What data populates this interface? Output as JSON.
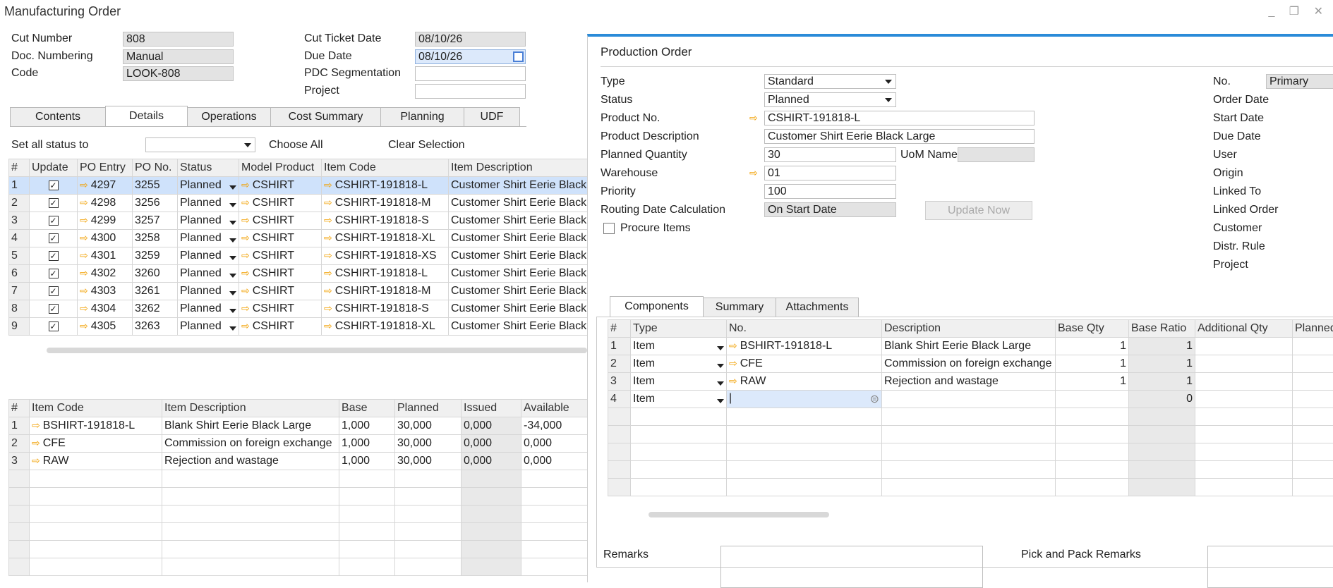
{
  "window": {
    "title": "Manufacturing Order",
    "controls": "_ ❐ ✕"
  },
  "header": {
    "cut_number_label": "Cut Number",
    "cut_number": "808",
    "doc_numbering_label": "Doc. Numbering",
    "doc_numbering": "Manual",
    "code_label": "Code",
    "code": "LOOK-808",
    "cut_ticket_date_label": "Cut Ticket Date",
    "cut_ticket_date": "08/10/26",
    "due_date_label": "Due Date",
    "due_date": "08/10/26",
    "pdc_label": "PDC Segmentation",
    "pdc": "",
    "project_label": "Project",
    "project": ""
  },
  "tabs": [
    "Contents",
    "Details",
    "Operations",
    "Cost Summary",
    "Planning",
    "UDF"
  ],
  "status_bar": {
    "set_all_label": "Set all status to",
    "choose_all": "Choose All",
    "clear_selection": "Clear Selection"
  },
  "po_table": {
    "headers": [
      "#",
      "Update",
      "PO Entry",
      "PO No.",
      "Status",
      "Model Product",
      "Item Code",
      "Item Description"
    ],
    "rows": [
      [
        "1",
        "4297",
        "3255",
        "Planned",
        "CSHIRT",
        "CSHIRT-191818-L",
        "Customer Shirt Eerie Black"
      ],
      [
        "2",
        "4298",
        "3256",
        "Planned",
        "CSHIRT",
        "CSHIRT-191818-M",
        "Customer Shirt Eerie Black"
      ],
      [
        "3",
        "4299",
        "3257",
        "Planned",
        "CSHIRT",
        "CSHIRT-191818-S",
        "Customer Shirt Eerie Black"
      ],
      [
        "4",
        "4300",
        "3258",
        "Planned",
        "CSHIRT",
        "CSHIRT-191818-XL",
        "Customer Shirt Eerie Black"
      ],
      [
        "5",
        "4301",
        "3259",
        "Planned",
        "CSHIRT",
        "CSHIRT-191818-XS",
        "Customer Shirt Eerie Black"
      ],
      [
        "6",
        "4302",
        "3260",
        "Planned",
        "CSHIRT",
        "CSHIRT-191818-L",
        "Customer Shirt Eerie Black"
      ],
      [
        "7",
        "4303",
        "3261",
        "Planned",
        "CSHIRT",
        "CSHIRT-191818-M",
        "Customer Shirt Eerie Black"
      ],
      [
        "8",
        "4304",
        "3262",
        "Planned",
        "CSHIRT",
        "CSHIRT-191818-S",
        "Customer Shirt Eerie Black"
      ],
      [
        "9",
        "4305",
        "3263",
        "Planned",
        "CSHIRT",
        "CSHIRT-191818-XL",
        "Customer Shirt Eerie Black"
      ]
    ]
  },
  "comp_table": {
    "headers": [
      "#",
      "Item Code",
      "Item Description",
      "Base",
      "Planned",
      "Issued",
      "Available"
    ],
    "rows": [
      [
        "1",
        "BSHIRT-191818-L",
        "Blank Shirt Eerie Black Large",
        "1,000",
        "30,000",
        "0,000",
        "-34,000"
      ],
      [
        "2",
        "CFE",
        "Commission on foreign exchange",
        "1,000",
        "30,000",
        "0,000",
        "0,000"
      ],
      [
        "3",
        "RAW",
        "Rejection and wastage",
        "1,000",
        "30,000",
        "0,000",
        "0,000"
      ]
    ]
  },
  "production_order": {
    "title": "Production Order",
    "type_label": "Type",
    "type": "Standard",
    "status_label": "Status",
    "status": "Planned",
    "product_no_label": "Product No.",
    "product_no": "CSHIRT-191818-L",
    "product_desc_label": "Product Description",
    "product_desc": "Customer Shirt Eerie Black Large",
    "planned_qty_label": "Planned Quantity",
    "planned_qty": "30",
    "uom_label": "UoM Name",
    "uom": "",
    "warehouse_label": "Warehouse",
    "warehouse": "01",
    "priority_label": "Priority",
    "priority": "100",
    "routing_label": "Routing Date Calculation",
    "routing": "On Start Date",
    "update_now": "Update Now",
    "procure_items": "Procure Items",
    "right_labels": [
      "No.",
      "Order Date",
      "Start Date",
      "Due Date",
      "User",
      "Origin",
      "Linked To",
      "Linked Order",
      "Customer",
      "Distr. Rule",
      "Project"
    ],
    "no_value": "Primary",
    "tabs": [
      "Components",
      "Summary",
      "Attachments"
    ],
    "remarks_label": "Remarks",
    "pick_pack_label": "Pick and Pack Remarks"
  },
  "po_components": {
    "headers": [
      "#",
      "Type",
      "No.",
      "Description",
      "Base Qty",
      "Base Ratio",
      "Additional Qty",
      "Planned"
    ],
    "rows": [
      [
        "1",
        "Item",
        "BSHIRT-191818-L",
        "Blank Shirt Eerie Black Large",
        "1",
        "1"
      ],
      [
        "2",
        "Item",
        "CFE",
        "Commission on foreign exchange",
        "1",
        "1"
      ],
      [
        "3",
        "Item",
        "RAW",
        "Rejection and wastage",
        "1",
        "1"
      ],
      [
        "4",
        "Item",
        "",
        "",
        "",
        "0"
      ]
    ]
  }
}
